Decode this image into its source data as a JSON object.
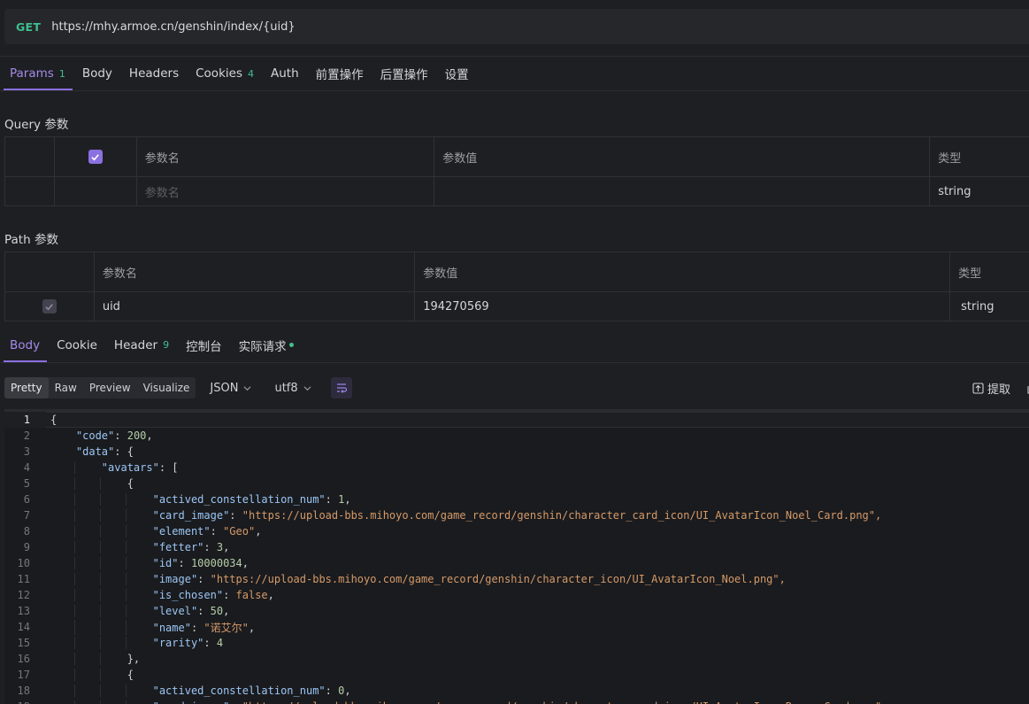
{
  "request": {
    "method": "GET",
    "url": "https://mhy.armoe.cn/genshin/index/{uid}"
  },
  "request_tabs": [
    {
      "label": "Params",
      "count": "1"
    },
    {
      "label": "Body"
    },
    {
      "label": "Headers"
    },
    {
      "label": "Cookies",
      "count": "4"
    },
    {
      "label": "Auth"
    },
    {
      "label": "前置操作"
    },
    {
      "label": "后置操作"
    },
    {
      "label": "设置"
    }
  ],
  "query": {
    "title": "Query 参数",
    "headers": {
      "name": "参数名",
      "value": "参数值",
      "type": "类型"
    },
    "placeholder_name": "参数名",
    "empty_row_type": "string"
  },
  "path": {
    "title": "Path 参数",
    "headers": {
      "name": "参数名",
      "value": "参数值",
      "type": "类型"
    },
    "row": {
      "name": "uid",
      "value": "194270569",
      "type": "string"
    }
  },
  "response_tabs": [
    {
      "label": "Body"
    },
    {
      "label": "Cookie"
    },
    {
      "label": "Header",
      "count": "9"
    },
    {
      "label": "控制台"
    },
    {
      "label": "实际请求"
    }
  ],
  "toolbar": {
    "views": [
      "Pretty",
      "Raw",
      "Preview",
      "Visualize"
    ],
    "format": "JSON",
    "encoding": "utf8",
    "extract_label": "提取"
  },
  "code_lines": [
    "{",
    "    \"code\": 200,",
    "    \"data\": {",
    "        \"avatars\": [",
    "            {",
    "                \"actived_constellation_num\": 1,",
    "                \"card_image\": \"https://upload-bbs.mihoyo.com/game_record/genshin/character_card_icon/UI_AvatarIcon_Noel_Card.png\",",
    "                \"element\": \"Geo\",",
    "                \"fetter\": 3,",
    "                \"id\": 10000034,",
    "                \"image\": \"https://upload-bbs.mihoyo.com/game_record/genshin/character_icon/UI_AvatarIcon_Noel.png\",",
    "                \"is_chosen\": false,",
    "                \"level\": 50,",
    "                \"name\": \"诺艾尔\",",
    "                \"rarity\": 4",
    "            },",
    "            {",
    "                \"actived_constellation_num\": 0,",
    "                \"card_image\": \"https://upload-bbs.mihoyo.com/game_record/genshin/character_card_icon/UI_AvatarIcon_Razor_Card.png\","
  ],
  "colors": {
    "accent": "#8a6fe0",
    "success": "#3fbf8f",
    "string": "#d49a6a",
    "key": "#9cc6f5",
    "number": "#b5cea8"
  }
}
